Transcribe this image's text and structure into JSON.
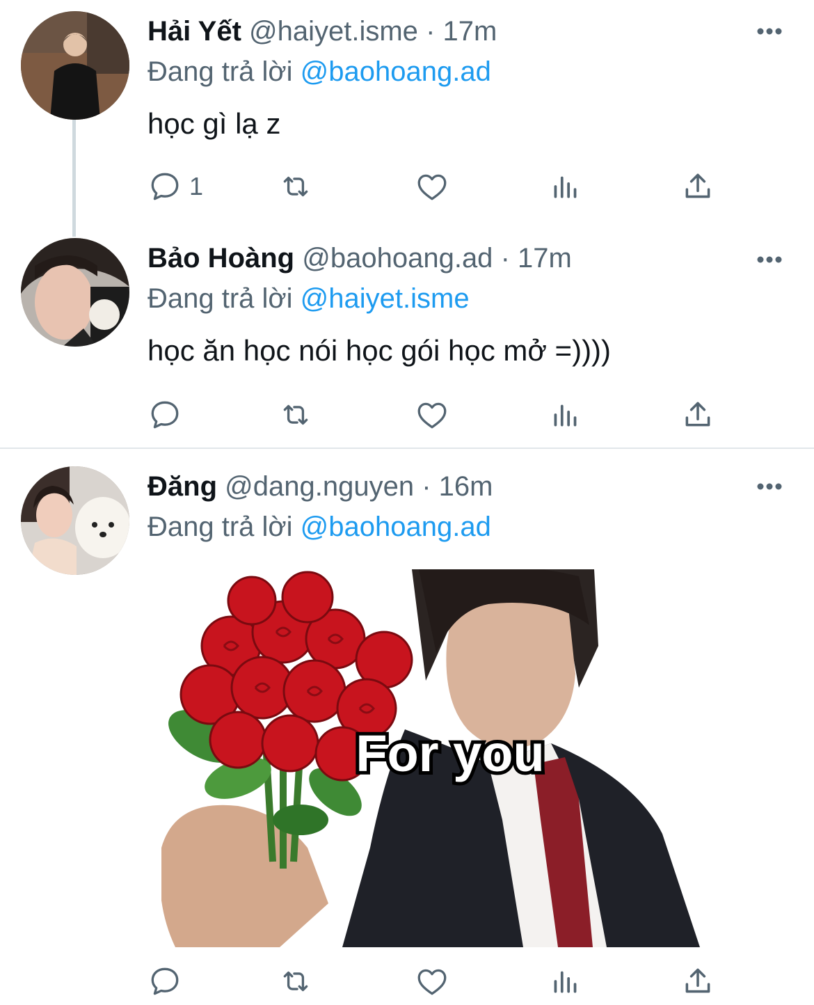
{
  "tweets": [
    {
      "name": "Hải Yết",
      "handle": "@haiyet.isme",
      "dot": "·",
      "time": "17m",
      "replying_prefix": "Đang trả lời",
      "replying_to": "@baohoang.ad",
      "text": "học gì lạ z",
      "reply_count": "1"
    },
    {
      "name": "Bảo Hoàng",
      "handle": "@baohoang.ad",
      "dot": "·",
      "time": "17m",
      "replying_prefix": "Đang trả lời",
      "replying_to": "@haiyet.isme",
      "text": "học ăn học nói học gói học mở =))))",
      "reply_count": ""
    },
    {
      "name": "Đăng",
      "handle": "@dang.nguyen",
      "dot": "·",
      "time": "16m",
      "replying_prefix": "Đang trả lời",
      "replying_to": "@baohoang.ad",
      "media_caption": "For you",
      "reply_count": ""
    }
  ],
  "icons": {
    "reply": "speech-bubble-icon",
    "retweet": "retweet-icon",
    "like": "heart-icon",
    "views": "bar-chart-icon",
    "share": "share-icon",
    "more": "more-dots-icon"
  },
  "colors": {
    "text_primary": "#0f1419",
    "text_secondary": "#536471",
    "mention": "#1d9bf0",
    "rose_red": "#c8141e"
  }
}
